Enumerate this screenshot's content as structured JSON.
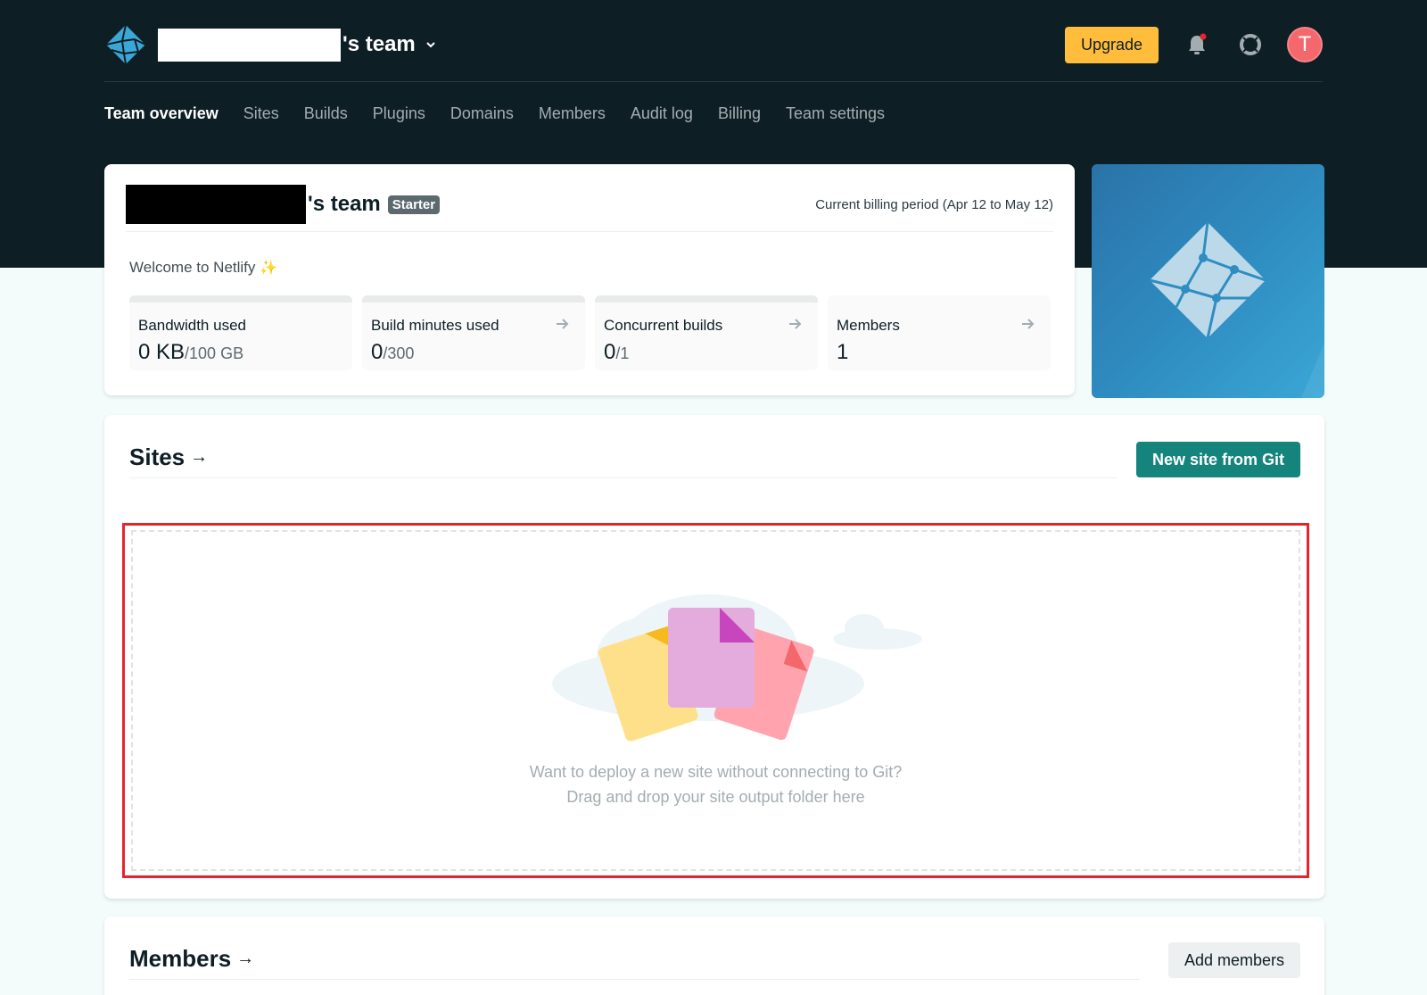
{
  "header": {
    "team_suffix": "'s team",
    "upgrade_label": "Upgrade"
  },
  "nav": {
    "items": [
      "Team overview",
      "Sites",
      "Builds",
      "Plugins",
      "Domains",
      "Members",
      "Audit log",
      "Billing",
      "Team settings"
    ]
  },
  "user": {
    "avatar_initial": "T"
  },
  "team_card": {
    "title_suffix": "'s team",
    "plan_badge": "Starter",
    "billing_period": "Current billing period (Apr 12 to May 12)",
    "welcome": "Welcome to Netlify",
    "stats": [
      {
        "label": "Bandwidth used",
        "value": "0 KB",
        "limit": "/100 GB"
      },
      {
        "label": "Build minutes used",
        "value": "0",
        "limit": "/300"
      },
      {
        "label": "Concurrent builds",
        "value": "0",
        "limit": "/1"
      },
      {
        "label": "Members",
        "value": "1",
        "limit": ""
      }
    ]
  },
  "sites": {
    "title": "Sites",
    "new_site_label": "New site from Git",
    "dropzone_line1": "Want to deploy a new site without connecting to Git?",
    "dropzone_line2": "Drag and drop your site output folder here"
  },
  "members": {
    "title": "Members",
    "add_label": "Add members"
  },
  "colors": {
    "topbar": "#0e1e25",
    "upgrade": "#ffbd3b",
    "primary_button": "#15847d",
    "highlight": "#e7242b",
    "avatar": "#f4676c"
  }
}
